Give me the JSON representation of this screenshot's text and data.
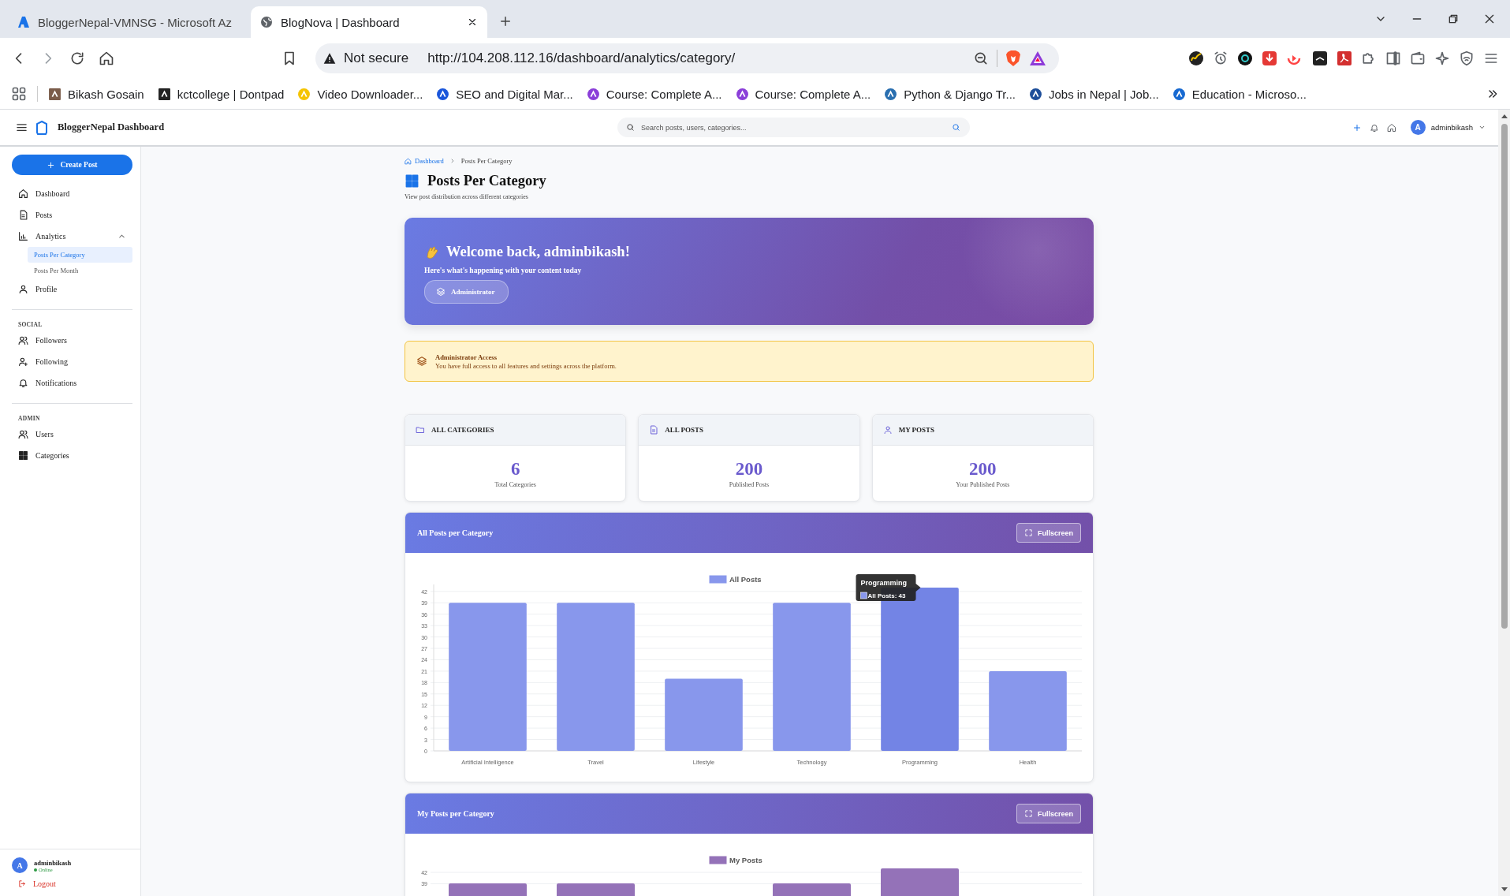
{
  "browser": {
    "tabs": [
      {
        "title": "BloggerNepal-VMNSG - Microsoft Az",
        "selected": false
      },
      {
        "title": "BlogNova | Dashboard",
        "selected": true
      }
    ],
    "security_label": "Not secure",
    "url": "http://104.208.112.16/dashboard/analytics/category/",
    "bookmarks": [
      "Bikash Gosain",
      "kctcollege | Dontpad",
      "Video Downloader...",
      "SEO and Digital Mar...",
      "Course: Complete A...",
      "Course: Complete A...",
      "Python & Django Tr...",
      "Jobs in Nepal | Job...",
      "Education - Microso..."
    ]
  },
  "app_header": {
    "brand": "BloggerNepal Dashboard",
    "search_placeholder": "Search posts, users, categories...",
    "avatar": "A",
    "user": "adminbikash"
  },
  "sidebar": {
    "create_button": "Create Post",
    "sections": [
      {
        "items": [
          {
            "label": "Dashboard",
            "selected": false
          },
          {
            "label": "Posts",
            "selected": false
          },
          {
            "label": "Analytics",
            "selected": false,
            "expanded": true,
            "children": [
              {
                "label": "Posts Per Category",
                "selected": true
              },
              {
                "label": "Posts Per Month",
                "selected": false
              }
            ]
          },
          {
            "label": "Profile",
            "selected": false
          }
        ]
      },
      {
        "heading": "SOCIAL",
        "items": [
          {
            "label": "Followers",
            "selected": false
          },
          {
            "label": "Following",
            "selected": false
          },
          {
            "label": "Notifications",
            "selected": false
          }
        ]
      },
      {
        "heading": "ADMIN",
        "items": [
          {
            "label": "Users",
            "selected": false
          },
          {
            "label": "Categories",
            "selected": false
          }
        ]
      }
    ],
    "footer": {
      "avatar": "A",
      "user": "adminbikash",
      "status": "Online",
      "logout": "Logout"
    }
  },
  "main": {
    "breadcrumb": [
      "Dashboard",
      "Posts Per Category"
    ],
    "title": "Posts Per Category",
    "subtitle": "View post distribution across different categories",
    "welcome": {
      "title": "Welcome back, adminbikash!",
      "subtitle": "Here's what's happening with your content today",
      "badge": "Administrator"
    },
    "alert": {
      "title": "Administrator Access",
      "text": "You have full access to all features and settings across the platform."
    },
    "stats": [
      {
        "label": "ALL CATEGORIES",
        "value": "6",
        "caption": "Total Categories"
      },
      {
        "label": "ALL POSTS",
        "value": "200",
        "caption": "Published Posts"
      },
      {
        "label": "MY POSTS",
        "value": "200",
        "caption": "Your Published Posts"
      }
    ],
    "charts": [
      {
        "title": "All Posts per Category",
        "button": "Fullscreen",
        "highlighted": [
          false,
          false,
          false,
          false,
          true,
          false
        ],
        "tooltip": {
          "title": "Programming",
          "text": "All Posts: 43"
        },
        "chart_data": {
          "type": "bar",
          "grid": true,
          "categories": [
            "Artificial Intelligence",
            "Travel",
            "Lifestyle",
            "Technology",
            "Programming",
            "Health"
          ],
          "series": [
            {
              "name": "All Posts",
              "color": "#8897ec",
              "values": [
                39,
                39,
                19,
                39,
                43,
                21
              ]
            }
          ],
          "ylim": [
            0,
            43
          ],
          "yticks": [
            0,
            3,
            6,
            9,
            12,
            15,
            18,
            21,
            24,
            27,
            30,
            33,
            36,
            39,
            42
          ]
        }
      },
      {
        "title": "My Posts per Category",
        "button": "Fullscreen",
        "legend": "My Posts",
        "y_tick_labels": [
          "42",
          "39"
        ]
      }
    ]
  }
}
